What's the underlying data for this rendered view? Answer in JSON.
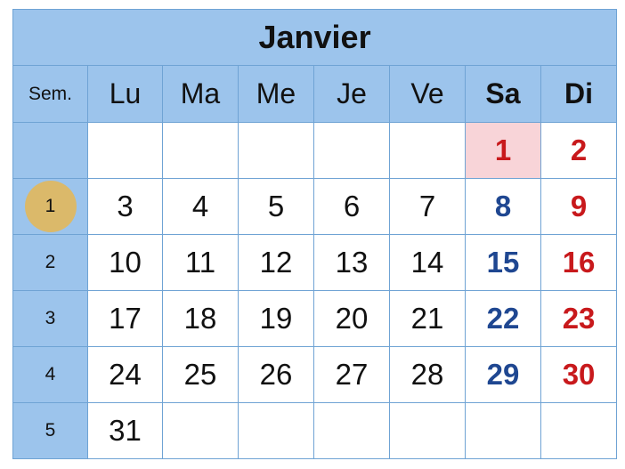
{
  "month": "Janvier",
  "week_header": "Sem.",
  "day_headers": [
    "Lu",
    "Ma",
    "Me",
    "Je",
    "Ve",
    "Sa",
    "Di"
  ],
  "current_week": "1",
  "holiday": "1",
  "colors": {
    "header_bg": "#9cc4ec",
    "grid": "#6fa3d4",
    "saturday": "#1f4791",
    "sunday": "#c8191c",
    "holiday_bg": "#f8d4d8",
    "current_week_circle": "#dbb96a"
  },
  "weeks": [
    {
      "week": "",
      "days": [
        "",
        "",
        "",
        "",
        "",
        "1",
        "2"
      ]
    },
    {
      "week": "1",
      "days": [
        "3",
        "4",
        "5",
        "6",
        "7",
        "8",
        "9"
      ]
    },
    {
      "week": "2",
      "days": [
        "10",
        "11",
        "12",
        "13",
        "14",
        "15",
        "16"
      ]
    },
    {
      "week": "3",
      "days": [
        "17",
        "18",
        "19",
        "20",
        "21",
        "22",
        "23"
      ]
    },
    {
      "week": "4",
      "days": [
        "24",
        "25",
        "26",
        "27",
        "28",
        "29",
        "30"
      ]
    },
    {
      "week": "5",
      "days": [
        "31",
        "",
        "",
        "",
        "",
        "",
        ""
      ]
    }
  ]
}
